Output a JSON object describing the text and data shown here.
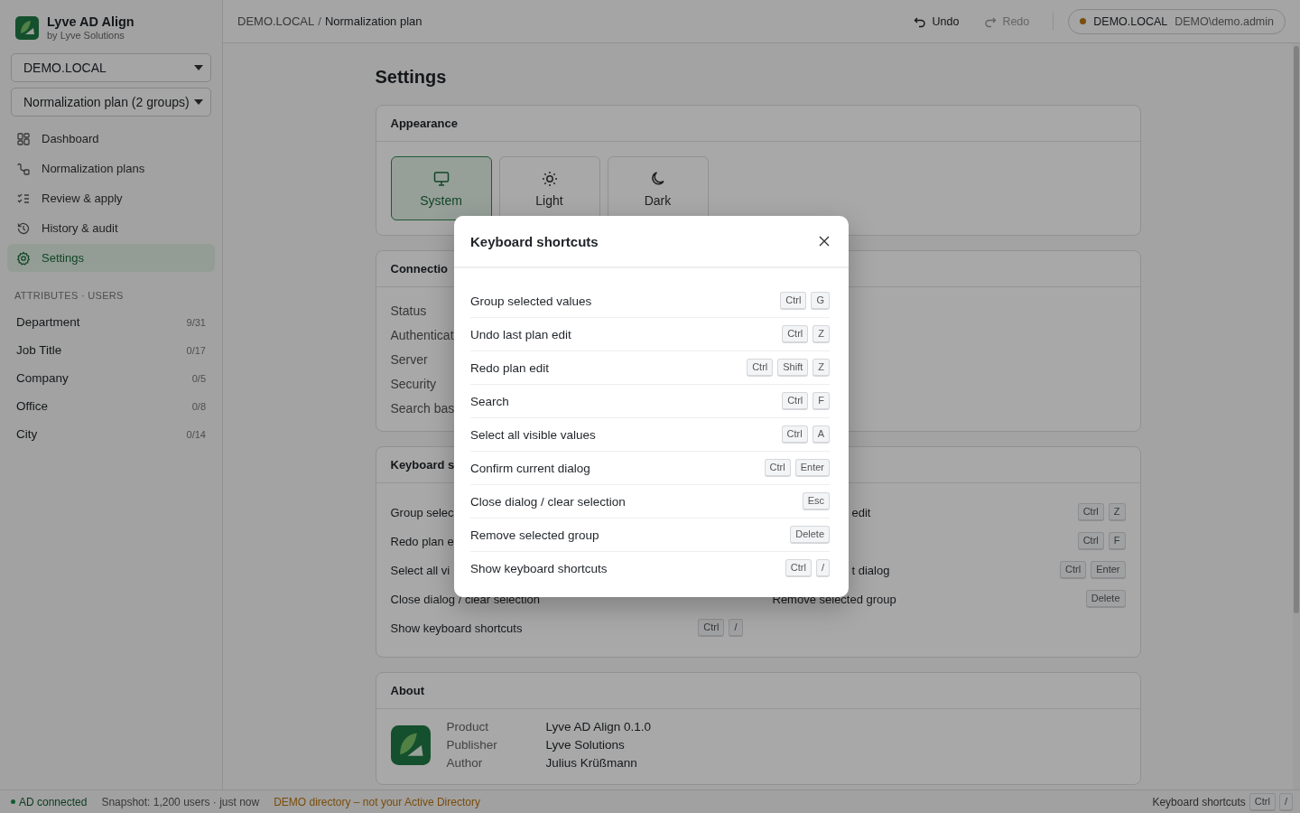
{
  "app": {
    "name": "Lyve AD Align",
    "subtitle": "by Lyve Solutions"
  },
  "sidebar": {
    "selects": [
      {
        "value": "DEMO.LOCAL"
      },
      {
        "value": "Normalization plan (2 groups)"
      }
    ],
    "nav": [
      {
        "label": "Dashboard",
        "selected": false
      },
      {
        "label": "Normalization plans",
        "selected": false
      },
      {
        "label": "Review & apply",
        "selected": false
      },
      {
        "label": "History & audit",
        "selected": false
      },
      {
        "label": "Settings",
        "selected": true
      }
    ],
    "section_title": "ATTRIBUTES · USERS",
    "attributes": [
      {
        "label": "Department",
        "count": "9/31"
      },
      {
        "label": "Job Title",
        "count": "0/17"
      },
      {
        "label": "Company",
        "count": "0/5"
      },
      {
        "label": "Office",
        "count": "0/8"
      },
      {
        "label": "City",
        "count": "0/14"
      }
    ]
  },
  "header": {
    "breadcrumb": [
      "DEMO.LOCAL",
      "Normalization plan"
    ],
    "breadcrumb_separator": "/",
    "undo": {
      "label": "Undo",
      "disabled": false
    },
    "redo": {
      "label": "Redo",
      "disabled": true
    },
    "connection": {
      "domain": "DEMO.LOCAL",
      "user": "DEMO\\demo.admin",
      "color": "#7a4d0a"
    }
  },
  "settings": {
    "title": "Settings",
    "appearance": {
      "title": "Appearance",
      "options": [
        {
          "label": "System",
          "selected": true
        },
        {
          "label": "Light",
          "selected": false
        },
        {
          "label": "Dark",
          "selected": false
        }
      ]
    },
    "connection": {
      "title": "Connectio",
      "labels": [
        "Status",
        "Authenticat",
        "Server",
        "Security",
        "Search bas"
      ]
    },
    "shortcuts": {
      "title": "Keyboard s",
      "columns": [
        [
          {
            "label": "Group selec",
            "clipped": false
          },
          {
            "label": "Redo plan e",
            "clipped": false
          },
          {
            "label": "Select all vi",
            "clipped": false
          },
          {
            "label": "Close dialog / clear selection",
            "clipped": false
          },
          {
            "label": "Show keyboard shortcuts",
            "clipped": false,
            "keys": [
              "Ctrl",
              "/"
            ]
          }
        ],
        [
          {
            "label": "edit",
            "clipped": true,
            "keys": [
              "Ctrl",
              "Z"
            ]
          },
          {
            "keys": [
              "Ctrl",
              "F"
            ]
          },
          {
            "label": "t dialog",
            "clipped": true,
            "keys": [
              "Ctrl",
              "Enter"
            ]
          },
          {
            "label": "Remove selected group",
            "clipped": false,
            "keys": [
              "Delete"
            ]
          }
        ]
      ]
    },
    "about": {
      "title": "About",
      "rows": [
        {
          "label": "Product",
          "value": "Lyve AD Align 0.1.0"
        },
        {
          "label": "Publisher",
          "value": "Lyve Solutions"
        },
        {
          "label": "Author",
          "value": "Julius Krüßmann"
        }
      ]
    }
  },
  "dialog": {
    "title": "Keyboard shortcuts",
    "rows": [
      {
        "label": "Group selected values",
        "keys": [
          "Ctrl",
          "G"
        ]
      },
      {
        "label": "Undo last plan edit",
        "keys": [
          "Ctrl",
          "Z"
        ]
      },
      {
        "label": "Redo plan edit",
        "keys": [
          "Ctrl",
          "Shift",
          "Z"
        ]
      },
      {
        "label": "Search",
        "keys": [
          "Ctrl",
          "F"
        ]
      },
      {
        "label": "Select all visible values",
        "keys": [
          "Ctrl",
          "A"
        ]
      },
      {
        "label": "Confirm current dialog",
        "keys": [
          "Ctrl",
          "Enter"
        ]
      },
      {
        "label": "Close dialog / clear selection",
        "keys": [
          "Esc"
        ]
      },
      {
        "label": "Remove selected group",
        "keys": [
          "Delete"
        ]
      },
      {
        "label": "Show keyboard shortcuts",
        "keys": [
          "Ctrl",
          "/"
        ]
      }
    ]
  },
  "status_bar": {
    "connected": {
      "label": "AD connected",
      "color": "#145b32"
    },
    "snapshot": "Snapshot: 1,200 users · just now",
    "warning": "DEMO directory – not your Active Directory",
    "shortcut_label": "Keyboard shortcuts",
    "keys": [
      "Ctrl",
      "/"
    ]
  }
}
